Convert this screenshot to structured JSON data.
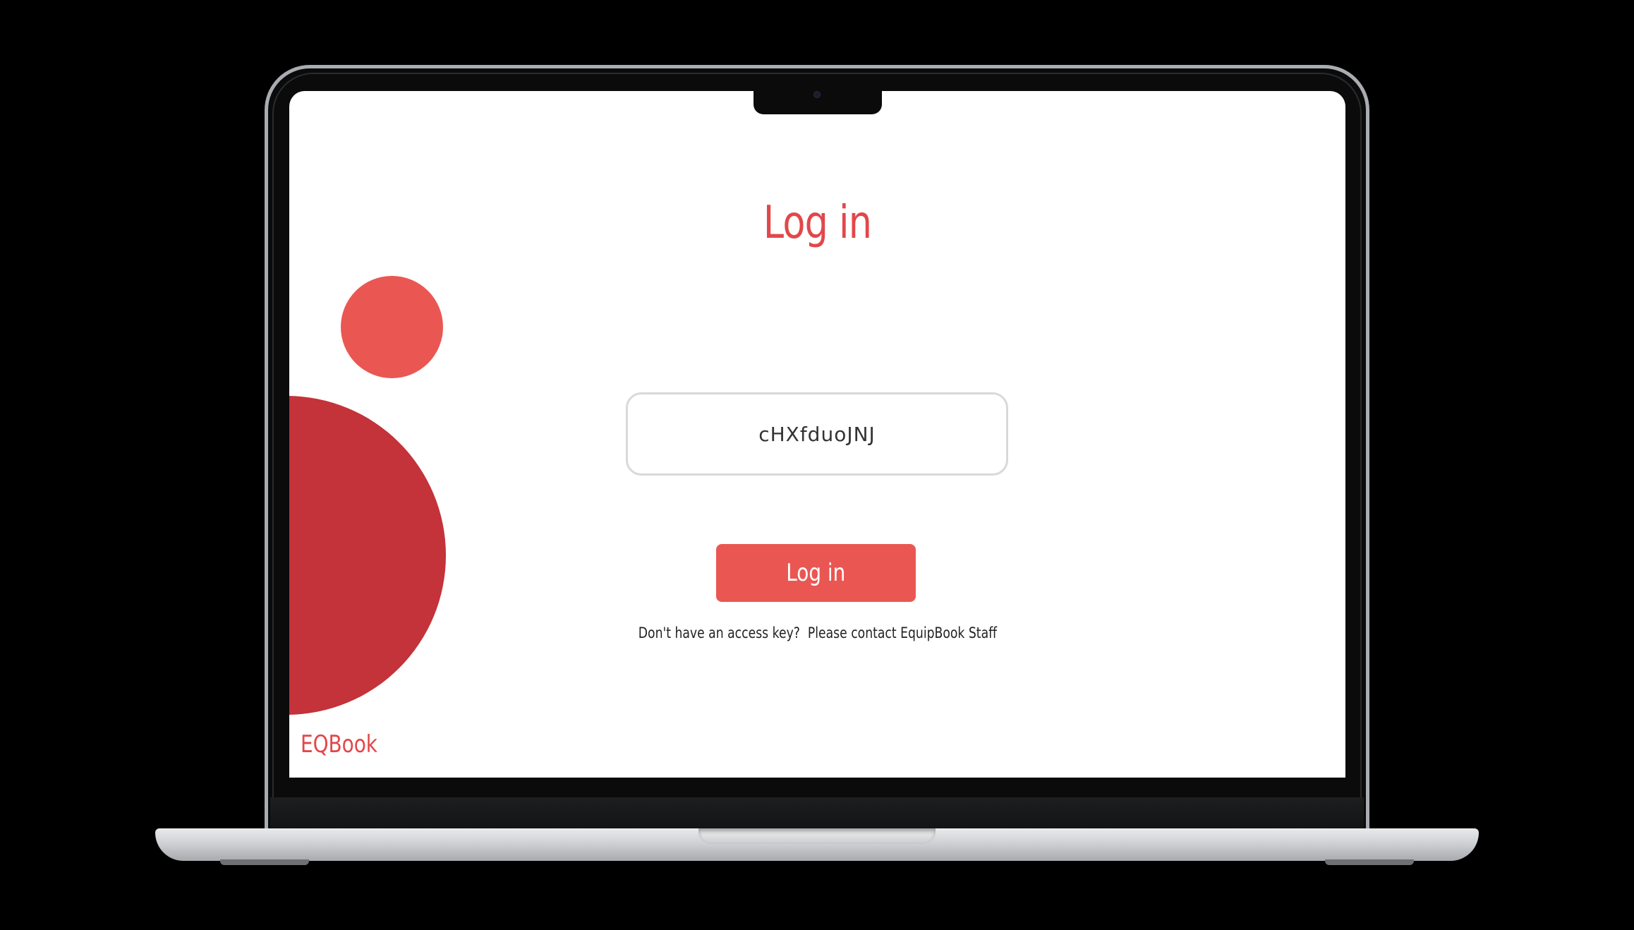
{
  "app": {
    "brand": "EQBook",
    "accent_color": "#ea5752",
    "deep_accent_color": "#c4323a"
  },
  "login": {
    "title": "Log in",
    "access_key_value": "cHXfduoJNJ",
    "button_label": "Log in",
    "help_text": "Don't have an access key?  Please contact EquipBook Staff"
  },
  "device": {
    "frame": "laptop",
    "icons": [
      "camera-icon"
    ]
  }
}
